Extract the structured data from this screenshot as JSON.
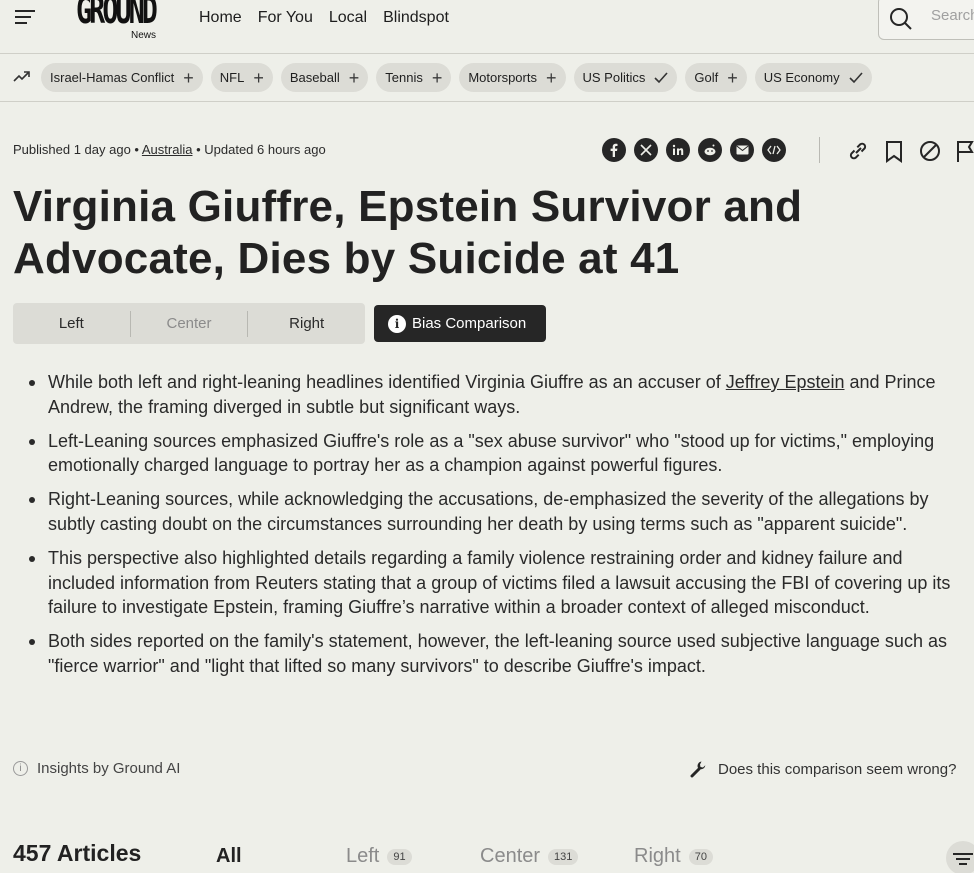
{
  "header": {
    "logo_main": "GROUND",
    "logo_sub": "News",
    "nav": [
      "Home",
      "For You",
      "Local",
      "Blindspot"
    ],
    "search_placeholder": "Search"
  },
  "topics": [
    {
      "label": "Israel-Hamas Conflict",
      "followed": false
    },
    {
      "label": "NFL",
      "followed": false
    },
    {
      "label": "Baseball",
      "followed": false
    },
    {
      "label": "Tennis",
      "followed": false
    },
    {
      "label": "Motorsports",
      "followed": false
    },
    {
      "label": "US Politics",
      "followed": true
    },
    {
      "label": "Golf",
      "followed": false
    },
    {
      "label": "US Economy",
      "followed": true
    }
  ],
  "meta": {
    "published": "Published 1 day ago •",
    "location": "Australia",
    "updated": "• Updated 6 hours ago"
  },
  "share_icons": [
    "facebook-icon",
    "x-icon",
    "linkedin-icon",
    "reddit-icon",
    "email-icon",
    "embed-icon"
  ],
  "article": {
    "title": "Virginia Giuffre, Epstein Survivor and Advocate, Dies by Suicide at 41"
  },
  "tabs": {
    "left": "Left",
    "center": "Center",
    "right": "Right",
    "bias_comparison": "Bias Comparison"
  },
  "bullets": {
    "b1_pre": "While both left and right-leaning headlines identified Virginia Giuffre as an accuser of ",
    "b1_link": "Jeffrey Epstein",
    "b1_post": " and Prince Andrew, the framing diverged in subtle but significant ways.",
    "b2": "Left-Leaning sources emphasized Giuffre's role as a \"sex abuse survivor\" who \"stood up for victims,\" employing emotionally charged language to portray her as a champion against powerful figures.",
    "b3": "Right-Leaning sources, while acknowledging the accusations, de-emphasized the severity of the allegations by subtly casting doubt on the circumstances surrounding her death by using terms such as \"apparent suicide\".",
    "b4": "This perspective also highlighted details regarding a family violence restraining order and kidney failure and included information from Reuters stating that a group of victims filed a lawsuit accusing the FBI of covering up its failure to investigate Epstein, framing Giuffre’s narrative within a broader context of alleged misconduct.",
    "b5": "Both sides reported on the family's statement, however, the left-leaning source used subjective language such as \"fierce warrior\" and \"light that lifted so many survivors\" to describe Giuffre's impact."
  },
  "insights": {
    "label": "Insights by Ground AI",
    "feedback": "Does this comparison seem wrong?"
  },
  "articles": {
    "count_label": "457 Articles",
    "tab_all": "All",
    "tab_left": "Left",
    "left_count": "91",
    "tab_center": "Center",
    "center_count": "131",
    "tab_right": "Right",
    "right_count": "70"
  }
}
